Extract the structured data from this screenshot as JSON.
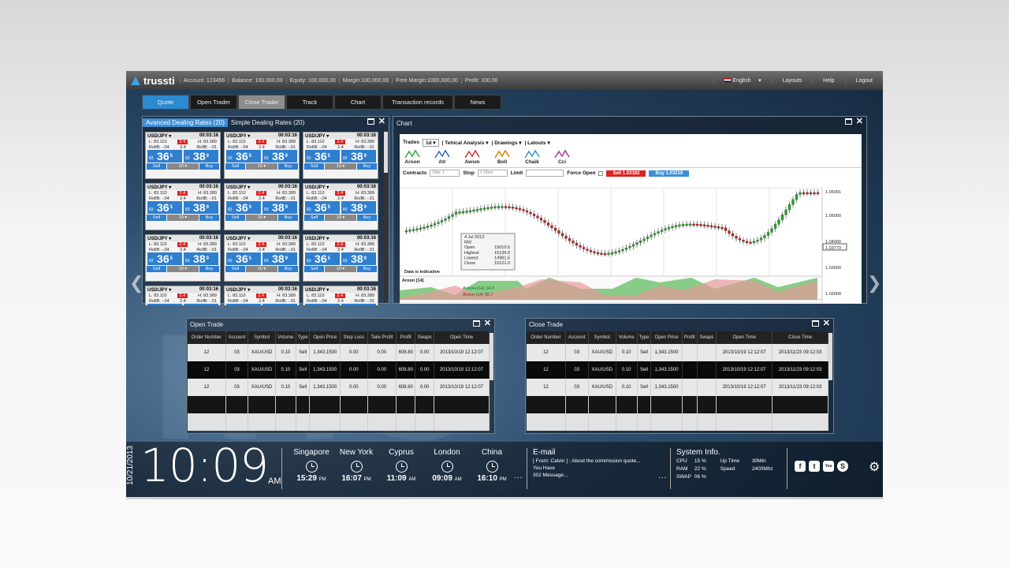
{
  "header": {
    "brand": "trussti",
    "account": "Account:  123456",
    "balance": "Balance:  100,000,00",
    "equity": "Equity:  100,000,00",
    "margin": "Margin:100,000,00",
    "free_margin": "Free Margin:1000,000,00",
    "profit": "Profit:  100,00",
    "language": "English",
    "layouts": "Layouts",
    "help": "Help",
    "logout": "Logout"
  },
  "nav": {
    "tabs": [
      "Quote",
      "Open Trader",
      "Close Trader",
      "Track",
      "Chart",
      "Transaction records",
      "News"
    ]
  },
  "dealing": {
    "tab_advanced": "Avanced Dealing Rates (20)",
    "tab_simple": "Simple Dealing Rates (20)",
    "tile": {
      "symbol": "USD/JPY",
      "time": "00:03:16",
      "low": "L: 83.110",
      "spread": "2.4",
      "high": "H: 83.389",
      "roll_b_label": "RollB: -.04",
      "mid": "2.4",
      "roll_s_label": "RollB: -.01",
      "sell_prefix": "83",
      "sell_big": "36",
      "sell_sup": "5",
      "buy_prefix": "83",
      "buy_big": "38",
      "buy_sup": "9",
      "sell": "Sell",
      "qty": "10",
      "buy": "Buy"
    }
  },
  "chart": {
    "title": "Chart",
    "trades": "Trades",
    "interval": "1d",
    "tech": "Tehical Analysis",
    "drawings": "Drawings",
    "latouts": "Latouts",
    "indicators": [
      "Aroon",
      "Atr",
      "Awsm",
      "Boll",
      "Chaik",
      "Cci"
    ],
    "contracts": "Contracts",
    "side": "Side: 1",
    "stop": "Stop",
    "stop_ph": "± 10pts",
    "limit": "Limit",
    "force_open": "Force Open",
    "sell_btn": "Sell 1.03182",
    "buy_btn": "Buy 1.03219",
    "tooltip": {
      "date": "4 Jul 2013",
      "mid": "Mid",
      "open_l": "Open",
      "open_v": "15010.5",
      "high_l": "Highest",
      "high_v": "15139.0",
      "low_l": "Lowest",
      "low_v": "14981.5",
      "close_l": "Close",
      "close_v": "15121.0"
    },
    "indicative": "Data is indicative",
    "aroon_label": "Aroon",
    "aroon_period": "14",
    "aroon_up": "Aroon+(14)",
    "aroon_up_v": "14.3",
    "aroon_dn": "Aroon-(14)",
    "aroon_dn_v": "35.7",
    "y_ticks": [
      "1.05991",
      "1.05000",
      "1.04000",
      "1.03779",
      "1.03000",
      "1.02000"
    ]
  },
  "chart_data": {
    "type": "candlestick",
    "y_ticks": [
      1.05991,
      1.05,
      1.04,
      1.03779,
      1.03,
      1.02
    ],
    "last": 1.03779
  },
  "open_trade": {
    "title": "Open Trade",
    "columns": [
      "Order Number",
      "Account",
      "Symbol",
      "Volume",
      "Type",
      "Open Price",
      "Stop Loss",
      "Take Profit",
      "Profit",
      "Swaps",
      "Open Time"
    ],
    "rows": [
      [
        "12",
        "03",
        "XAU/USD",
        "0.10",
        "Sell",
        "1,343.1500",
        "0.00",
        "0.00",
        "608.80",
        "0.00",
        "2013/10/19 12:12:07"
      ],
      [
        "12",
        "03",
        "XAU/USD",
        "0.10",
        "Sell",
        "1,343.1500",
        "0.00",
        "0.00",
        "608.80",
        "0.00",
        "2013/10/19 12:12:07"
      ],
      [
        "12",
        "03",
        "XAU/USD",
        "0.10",
        "Sell",
        "1,343.1500",
        "0.00",
        "0.00",
        "608.80",
        "0.00",
        "2013/10/19 12:12:07"
      ]
    ]
  },
  "close_trade": {
    "title": "Close Trade",
    "columns": [
      "Order Number",
      "Account",
      "Symbol",
      "Volume",
      "Type",
      "Open Price",
      "Profit",
      "Swaps",
      "Open Time",
      "Close Time"
    ],
    "rows": [
      [
        "12",
        "03",
        "XAU/USD",
        "0.10",
        "Sell",
        "1,343.1500",
        "",
        "",
        "2013/10/19 12:12:07",
        "2013/11/23 09:12:03"
      ],
      [
        "12",
        "03",
        "XAU/USD",
        "0.10",
        "Sell",
        "1,343.1500",
        "",
        "",
        "2013/10/19 12:12:07",
        "2013/11/23 09:12:03"
      ],
      [
        "12",
        "03",
        "XAU/USD",
        "0.10",
        "Sell",
        "1,343.1500",
        "",
        "",
        "2013/10/19 12:12:07",
        "2013/11/23 09:12:03"
      ]
    ]
  },
  "footer": {
    "date": "10/21/2013",
    "time": "10:09",
    "ampm": "AM",
    "cities": [
      {
        "name": "Singapore",
        "time": "15:29",
        "ap": "PM"
      },
      {
        "name": "New York",
        "time": "16:07",
        "ap": "PM"
      },
      {
        "name": "Cyprus",
        "time": "11:09",
        "ap": "AM"
      },
      {
        "name": "London",
        "time": "09:09",
        "ap": "AM"
      },
      {
        "name": "China",
        "time": "16:10",
        "ap": "PM"
      }
    ],
    "email_title": "E-mail",
    "email_line1": "[ From: Calvin ] : About the commission quote...",
    "email_line2": "You Have",
    "email_line3": "302 Message...",
    "sys_title": "System Info.",
    "cpu": "CPU",
    "cpu_v": "15 %",
    "ram": "RAM",
    "ram_v": "22 %",
    "swap": "SWAP",
    "swap_v": "06 %",
    "uptime": "Up Time",
    "uptime_v": "30Min",
    "speed": "Speed",
    "speed_v": "2400Mhz",
    "social": [
      "f",
      "t",
      "You",
      "S"
    ]
  }
}
